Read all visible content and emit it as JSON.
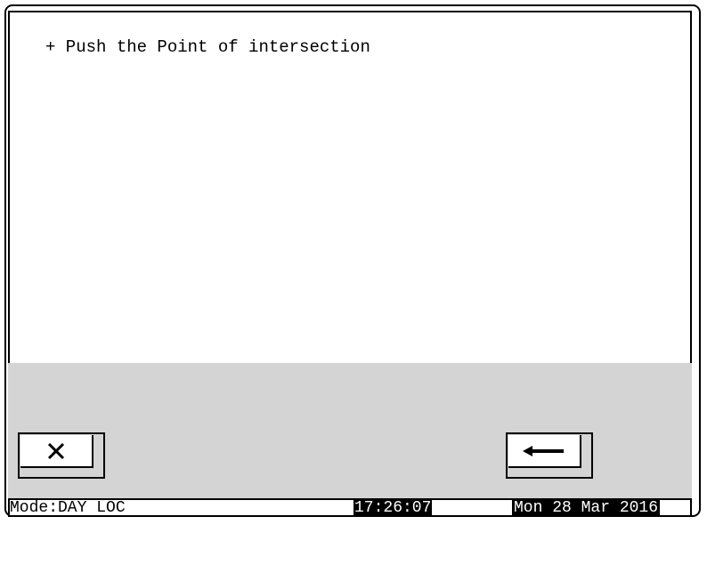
{
  "screen": {
    "prompt": "+ Push the Point of intersection"
  },
  "controls": {
    "cancel": {
      "icon": "close-icon"
    },
    "back": {
      "icon": "arrow-left-icon"
    }
  },
  "status_bar": {
    "mode": "Mode:DAY LOC",
    "time": "17:26:07",
    "date": "Mon 28 Mar 2016"
  }
}
